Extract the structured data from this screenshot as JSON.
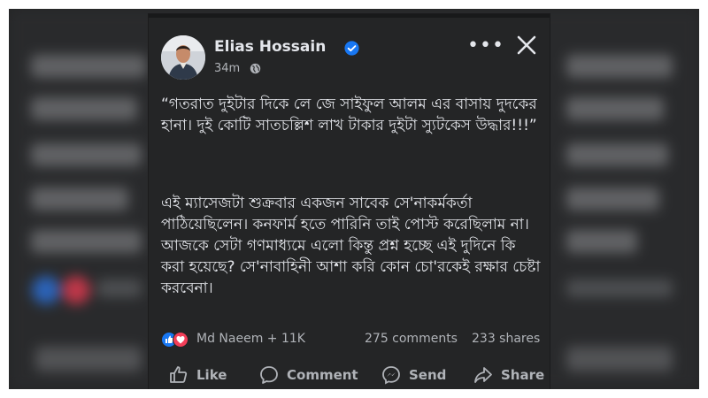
{
  "post": {
    "author_name": "Elias Hossain",
    "time": "34m",
    "paragraphs": [
      "“গতরাত দুইটার দিকে লে জে সাইফুল আলম এর বাসায় দুদকের হানা। দুই কোটি সাতচল্লিশ লাখ টাকার দুইটা স্যুটকেস উদ্ধার!!!”",
      "এই ম্যাসেজটা শুক্রবার একজন সাবেক সে'নাকর্মকর্তা পাঠিয়েছিলেন। কনফার্ম হতে পারিনি তাই পোস্ট করেছিলাম না। আজকে সেটা গণমাধ্যমে এলো কিন্তু প্রশ্ন হচ্ছে এই দুদিনে কি করা হয়েছে? সে'নাবাহিনী আশা করি কোন চো'রকেই রক্ষার চেষ্টা করবেনা।"
    ],
    "reactors": "Md Naeem + 11K",
    "comments": "275 comments",
    "shares": "233 shares"
  },
  "actions": {
    "like": "Like",
    "comment": "Comment",
    "send": "Send",
    "share": "Share"
  },
  "icons": {
    "verified": "verified-badge-icon",
    "audience": "globe-icon",
    "more": "more-options-icon",
    "close": "close-icon",
    "reaction_like": "like-reaction-icon",
    "reaction_love": "love-reaction-icon",
    "like": "thumbs-up-icon",
    "comment": "comment-bubble-icon",
    "send": "messenger-icon",
    "share": "share-arrow-icon"
  },
  "colors": {
    "card_bg": "#242526",
    "text_primary": "#e4e6eb",
    "text_secondary": "#b0b3b8",
    "verified_blue": "#1877f2",
    "love_red": "#f33e58"
  }
}
